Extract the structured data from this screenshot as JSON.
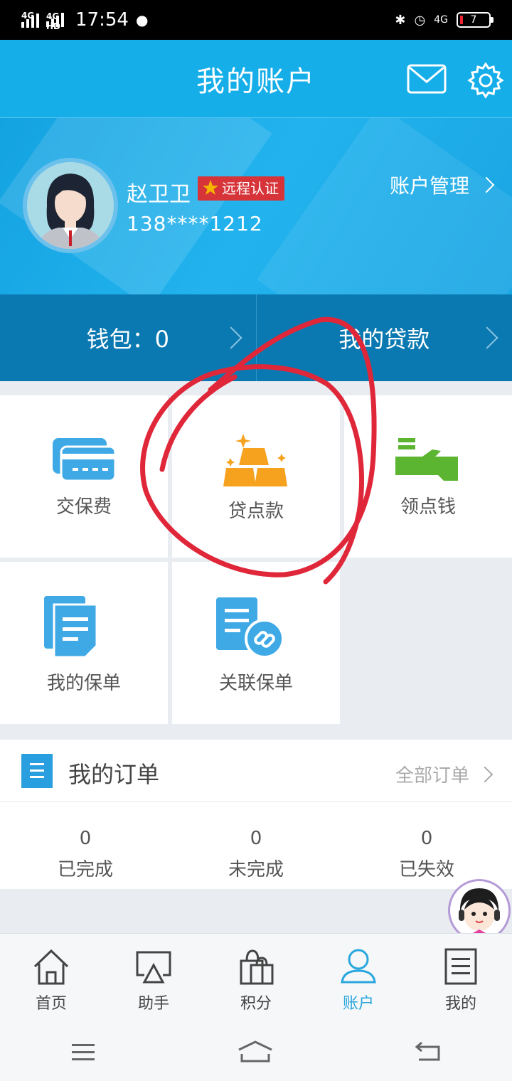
{
  "status_bar": {
    "network_1": "4G",
    "network_2": "4G HD",
    "time": "17:54",
    "battery": "7",
    "sim_right": "4G"
  },
  "header": {
    "title": "我的账户",
    "icons": [
      "mail-icon",
      "gear-icon"
    ]
  },
  "profile": {
    "name": "赵卫卫",
    "badge": "远程认证",
    "phone": "138****1212",
    "account_manage": "账户管理"
  },
  "strip": {
    "wallet": "钱包：0",
    "my_loan": "我的贷款"
  },
  "tiles": [
    {
      "label": "交保费",
      "icon": "card-icon"
    },
    {
      "label": "贷点款",
      "icon": "gold-bars-icon"
    },
    {
      "label": "领点钱",
      "icon": "hand-money-icon"
    },
    {
      "label": "我的保单",
      "icon": "document-icon"
    },
    {
      "label": "关联保单",
      "icon": "linked-document-icon"
    }
  ],
  "orders": {
    "title": "我的订单",
    "all": "全部订单",
    "stats": [
      {
        "count": "0",
        "label": "已完成"
      },
      {
        "count": "0",
        "label": "未完成"
      },
      {
        "count": "0",
        "label": "已失效"
      }
    ]
  },
  "tabbar": [
    {
      "label": "首页",
      "icon": "home-icon"
    },
    {
      "label": "助手",
      "icon": "cast-icon"
    },
    {
      "label": "积分",
      "icon": "shopping-bag-icon"
    },
    {
      "label": "账户",
      "icon": "person-icon",
      "active": true
    },
    {
      "label": "我的",
      "icon": "list-icon"
    }
  ],
  "colors": {
    "primary": "#16aee9",
    "strip": "#0b79b1",
    "accent": "#2aa7de",
    "annotation": "#e0273a"
  }
}
